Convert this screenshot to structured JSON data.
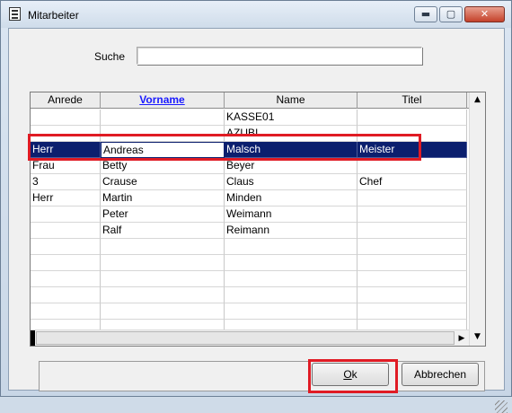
{
  "window": {
    "title": "Mitarbeiter",
    "min_glyph": "▬",
    "max_glyph": "▢",
    "close_glyph": "✕"
  },
  "search": {
    "label": "Suche",
    "value": "",
    "placeholder": ""
  },
  "grid": {
    "columns": [
      "Anrede",
      "Vorname",
      "Name",
      "Titel"
    ],
    "sorted_column": "Vorname",
    "rows": [
      [
        "",
        "",
        "KASSE01",
        ""
      ],
      [
        "",
        "",
        "AZUBI",
        ""
      ],
      [
        "Herr",
        "Andreas",
        "Malsch",
        "Meister"
      ],
      [
        "Frau",
        "Betty",
        "Beyer",
        ""
      ],
      [
        "3",
        "Crause",
        "Claus",
        "Chef"
      ],
      [
        "Herr",
        "Martin",
        "Minden",
        ""
      ],
      [
        "",
        "Peter",
        "Weimann",
        ""
      ],
      [
        "",
        "Ralf",
        "Reimann",
        ""
      ],
      [
        "",
        "",
        "",
        ""
      ],
      [
        "",
        "",
        "",
        ""
      ],
      [
        "",
        "",
        "",
        ""
      ],
      [
        "",
        "",
        "",
        ""
      ],
      [
        "",
        "",
        "",
        ""
      ],
      [
        "",
        "",
        "",
        ""
      ]
    ],
    "selected_row": 2,
    "scroll_up_glyph": "▲",
    "scroll_down_glyph": "▼",
    "scroll_right_glyph": "▶"
  },
  "buttons": {
    "ok_mnemonic": "O",
    "ok_rest": "k",
    "cancel": "Abbrechen"
  },
  "colors": {
    "selection": "#0b1f6e",
    "highlight": "#e01b24"
  }
}
